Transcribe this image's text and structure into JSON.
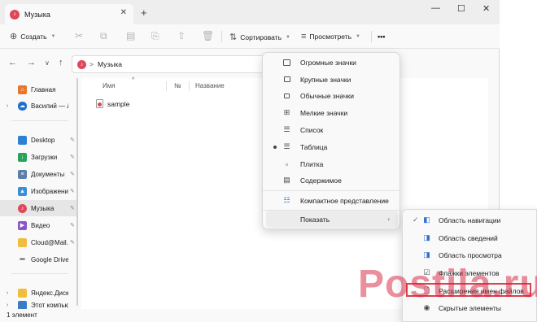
{
  "window": {
    "tab_title": "Музыка"
  },
  "toolbar": {
    "create_label": "Создать",
    "sort_label": "Сортировать",
    "view_label": "Просмотреть",
    "more_label": "•••"
  },
  "nav": {
    "breadcrumb_sep": ">",
    "breadcrumb_current": "Музыка"
  },
  "sidebar": {
    "items": [
      {
        "label": "Главная",
        "icon": "home-icon",
        "color": "#e8762b"
      },
      {
        "label": "Василий — Лич",
        "icon": "onedrive-icon",
        "color": "#1f6fd1"
      },
      {
        "label": "Desktop",
        "icon": "desktop-icon",
        "color": "#2f7fd4"
      },
      {
        "label": "Загрузки",
        "icon": "downloads-icon",
        "color": "#2aa35a"
      },
      {
        "label": "Документы",
        "icon": "documents-icon",
        "color": "#5b7fa8"
      },
      {
        "label": "Изображени",
        "icon": "pictures-icon",
        "color": "#3a8fd8"
      },
      {
        "label": "Музыка",
        "icon": "music-icon",
        "color": "#e0465a"
      },
      {
        "label": "Видео",
        "icon": "video-icon",
        "color": "#8a57c9"
      },
      {
        "label": "Cloud@Mail.",
        "icon": "folder-icon",
        "color": "#f2bd3c"
      },
      {
        "label": "Google Drive",
        "icon": "drive-icon",
        "color": "#4b4b4b"
      },
      {
        "label": "Яндекс.Диск",
        "icon": "folder-icon",
        "color": "#f2bd3c"
      },
      {
        "label": "Этот компьютер",
        "icon": "computer-icon",
        "color": "#3c7cc4"
      }
    ]
  },
  "main": {
    "columns": {
      "name": "Имя",
      "number": "№",
      "title": "Название"
    },
    "files": [
      {
        "name": "sample"
      }
    ]
  },
  "status": {
    "count_text": "1 элемент"
  },
  "view_menu": {
    "items": [
      {
        "label": "Огромные значки",
        "icon": "monitor-icon"
      },
      {
        "label": "Крупные значки",
        "icon": "monitor-icon"
      },
      {
        "label": "Обычные значки",
        "icon": "monitor-stand-icon"
      },
      {
        "label": "Мелкие значки",
        "icon": "small-icons-icon"
      },
      {
        "label": "Список",
        "icon": "list-icon"
      },
      {
        "label": "Таблица",
        "icon": "details-icon",
        "selected": true
      },
      {
        "label": "Плитка",
        "icon": "tiles-icon"
      },
      {
        "label": "Содержимое",
        "icon": "content-icon"
      },
      {
        "label": "Компактное представление",
        "icon": "compact-icon"
      },
      {
        "label": "Показать",
        "icon": "",
        "submenu": true
      }
    ]
  },
  "show_menu": {
    "items": [
      {
        "label": "Область навигации",
        "icon": "nav-pane-icon",
        "checked": true
      },
      {
        "label": "Область сведений",
        "icon": "details-pane-icon"
      },
      {
        "label": "Область просмотра",
        "icon": "preview-pane-icon"
      },
      {
        "label": "Флажки элементов",
        "icon": "checkbox-icon"
      },
      {
        "label": "Расширения имен файлов",
        "icon": "file-ext-icon",
        "highlighted": true
      },
      {
        "label": "Скрытые элементы",
        "icon": "eye-icon"
      }
    ]
  },
  "watermark": {
    "text": "Postila.ru"
  },
  "colors": {
    "accent": "#1f6fd1",
    "highlight_border": "#d8434c",
    "watermark": "#d71e3c"
  }
}
